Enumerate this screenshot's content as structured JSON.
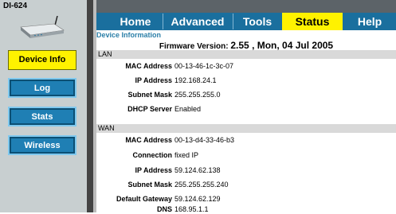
{
  "sidebar": {
    "model": "DI-624",
    "buttons": [
      {
        "label": "Device Info",
        "active": true
      },
      {
        "label": "Log",
        "active": false
      },
      {
        "label": "Stats",
        "active": false
      },
      {
        "label": "Wireless",
        "active": false
      }
    ]
  },
  "tabs": [
    {
      "label": "Home",
      "active": false
    },
    {
      "label": "Advanced",
      "active": false
    },
    {
      "label": "Tools",
      "active": false
    },
    {
      "label": "Status",
      "active": true
    },
    {
      "label": "Help",
      "active": false
    }
  ],
  "device_info": {
    "title": "Device Information",
    "firmware_label": "Firmware Version:",
    "firmware_value": "2.55 , Mon, 04 Jul 2005"
  },
  "lan": {
    "title": "LAN",
    "rows": [
      {
        "label": "MAC Address",
        "value": "00-13-46-1c-3c-07"
      },
      {
        "label": "IP Address",
        "value": "192.168.24.1"
      },
      {
        "label": "Subnet Mask",
        "value": "255.255.255.0"
      },
      {
        "label": "DHCP Server",
        "value": "Enabled"
      }
    ]
  },
  "wan": {
    "title": "WAN",
    "rows": [
      {
        "label": "MAC Address",
        "value": "00-13-d4-33-46-b3"
      },
      {
        "label": "Connection",
        "value": "fixed IP"
      },
      {
        "label": "IP Address",
        "value": "59.124.62.138"
      },
      {
        "label": "Subnet Mask",
        "value": "255.255.255.240"
      },
      {
        "label": "Default Gateway",
        "value": "59.124.62.129"
      },
      {
        "label": "DNS",
        "value": "168.95.1.1"
      }
    ]
  }
}
